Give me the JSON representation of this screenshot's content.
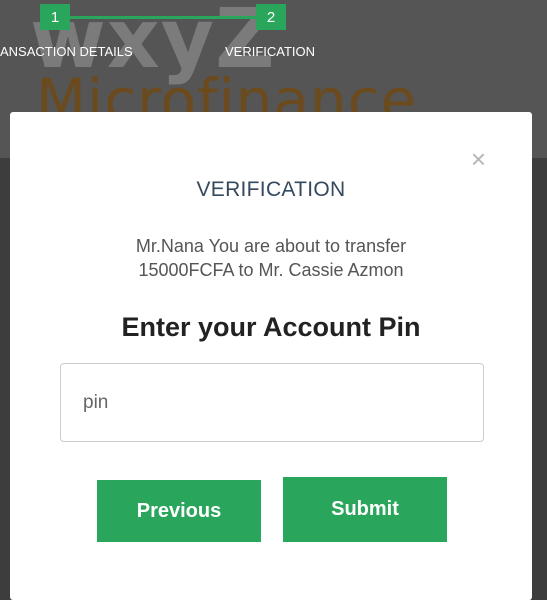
{
  "background": {
    "brand": "wxyZ",
    "brand_sub": "Microfinance",
    "stepper": {
      "steps": [
        {
          "number": "1",
          "label": "ANSACTION DETAILS"
        },
        {
          "number": "2",
          "label": "VERIFICATION"
        }
      ]
    }
  },
  "modal": {
    "close_label": "×",
    "title": "VERIFICATION",
    "message_line1": "Mr.Nana You are about to transfer",
    "message_line2": "15000FCFA to Mr. Cassie Azmon",
    "pin_heading": "Enter your Account Pin",
    "pin_input": {
      "value": "",
      "placeholder": "pin"
    },
    "previous_label": "Previous",
    "submit_label": "Submit"
  },
  "colors": {
    "accent": "#2aa55c",
    "title": "#34495e",
    "overlay": "#3d3d3d"
  }
}
